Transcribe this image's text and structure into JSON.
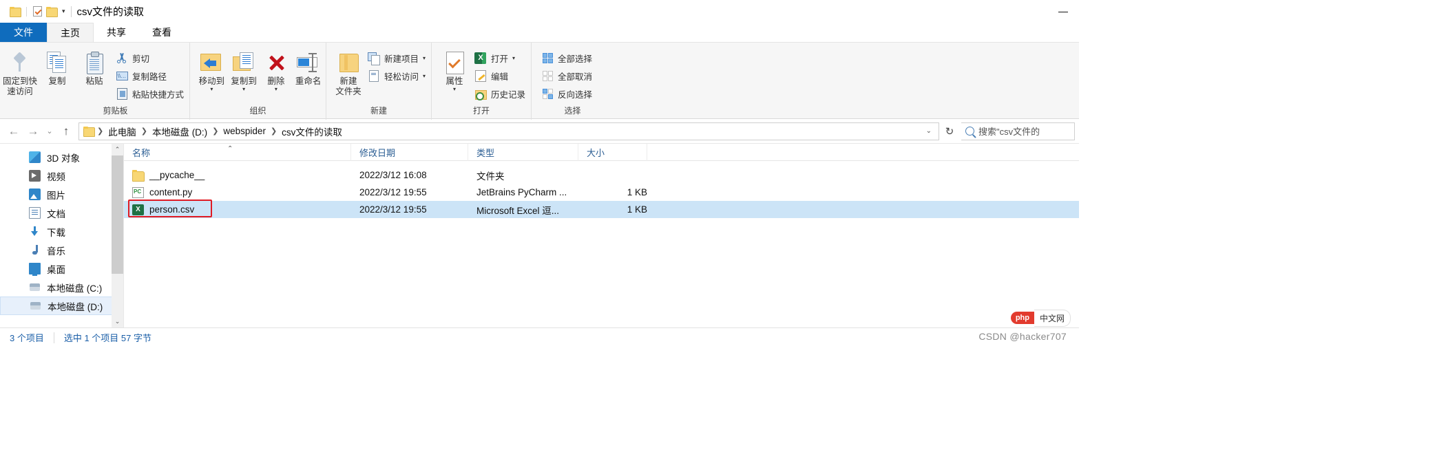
{
  "window": {
    "title": "csv文件的读取",
    "quick_access": [
      "folder-icon",
      "properties-check-icon",
      "new-folder-icon"
    ],
    "qat_caret": "▾",
    "minimize": "—"
  },
  "tabs": [
    {
      "label": "文件",
      "type": "file"
    },
    {
      "label": "主页",
      "type": "active"
    },
    {
      "label": "共享",
      "type": "normal"
    },
    {
      "label": "查看",
      "type": "normal"
    }
  ],
  "ribbon": {
    "groups": [
      {
        "label": "剪贴板",
        "big": [
          {
            "label_line1": "固定到快",
            "label_line2": "速访问",
            "icon": "pin-icon"
          },
          {
            "label_line1": "复制",
            "label_line2": "",
            "icon": "copy-icon"
          },
          {
            "label_line1": "粘贴",
            "label_line2": "",
            "icon": "paste-icon"
          }
        ],
        "small": [
          {
            "label": "剪切",
            "icon": "scissors-icon"
          },
          {
            "label": "复制路径",
            "icon": "copy-path-icon"
          },
          {
            "label": "粘贴快捷方式",
            "icon": "paste-shortcut-icon"
          }
        ]
      },
      {
        "label": "组织",
        "big": [
          {
            "label_line1": "移动到",
            "label_line2": "",
            "icon": "move-to-icon",
            "caret": "▾"
          },
          {
            "label_line1": "复制到",
            "label_line2": "",
            "icon": "copy-to-icon",
            "caret": "▾"
          },
          {
            "label_line1": "删除",
            "label_line2": "",
            "icon": "delete-icon",
            "caret": "▾"
          },
          {
            "label_line1": "重命名",
            "label_line2": "",
            "icon": "rename-icon"
          }
        ],
        "small": []
      },
      {
        "label": "新建",
        "big": [
          {
            "label_line1": "新建",
            "label_line2": "文件夹",
            "icon": "new-folder-icon"
          }
        ],
        "small": [
          {
            "label": "新建项目",
            "icon": "new-item-icon",
            "caret": "▾"
          },
          {
            "label": "轻松访问",
            "icon": "easy-access-icon",
            "caret": "▾"
          }
        ]
      },
      {
        "label": "打开",
        "big": [
          {
            "label_line1": "属性",
            "label_line2": "",
            "icon": "properties-icon",
            "caret": "▾"
          }
        ],
        "small": [
          {
            "label": "打开",
            "icon": "excel-icon",
            "caret": "▾"
          },
          {
            "label": "编辑",
            "icon": "edit-pencil-icon"
          },
          {
            "label": "历史记录",
            "icon": "history-icon"
          }
        ]
      },
      {
        "label": "选择",
        "big": [],
        "small": [
          {
            "label": "全部选择",
            "icon": "select-all-icon"
          },
          {
            "label": "全部取消",
            "icon": "select-none-icon"
          },
          {
            "label": "反向选择",
            "icon": "invert-selection-icon"
          }
        ]
      }
    ]
  },
  "address": {
    "back": "←",
    "forward": "→",
    "recent": "⌄",
    "up": "↑",
    "crumbs": [
      "此电脑",
      "本地磁盘 (D:)",
      "webspider",
      "csv文件的读取"
    ],
    "separator": "❯",
    "dropdown_caret": "⌄",
    "refresh": "↻",
    "search_placeholder": "搜索\"csv文件的"
  },
  "navpane": {
    "items": [
      {
        "label": "3D 对象",
        "icon": "3d-objects-icon",
        "selected": false
      },
      {
        "label": "视频",
        "icon": "videos-icon",
        "selected": false
      },
      {
        "label": "图片",
        "icon": "pictures-icon",
        "selected": false
      },
      {
        "label": "文档",
        "icon": "documents-icon",
        "selected": false
      },
      {
        "label": "下载",
        "icon": "downloads-icon",
        "selected": false
      },
      {
        "label": "音乐",
        "icon": "music-icon",
        "selected": false
      },
      {
        "label": "桌面",
        "icon": "desktop-icon",
        "selected": false
      },
      {
        "label": "本地磁盘 (C:)",
        "icon": "disk-icon",
        "selected": false
      },
      {
        "label": "本地磁盘 (D:)",
        "icon": "disk-icon",
        "selected": true
      }
    ],
    "scroll_up": "⌃",
    "scroll_down": "⌄"
  },
  "filelist": {
    "columns": [
      {
        "label": "名称",
        "sorted": true,
        "sort_caret": "⌃"
      },
      {
        "label": "修改日期"
      },
      {
        "label": "类型"
      },
      {
        "label": "大小"
      }
    ],
    "rows": [
      {
        "name": "__pycache__",
        "date": "2022/3/12 16:08",
        "type": "文件夹",
        "size": "",
        "icon": "folder-icon",
        "selected": false
      },
      {
        "name": "content.py",
        "date": "2022/3/12 19:55",
        "type": "JetBrains PyCharm ...",
        "size": "1 KB",
        "icon": "pycharm-file-icon",
        "selected": false
      },
      {
        "name": "person.csv",
        "date": "2022/3/12 19:55",
        "type": "Microsoft Excel 逗...",
        "size": "1 KB",
        "icon": "csv-file-icon",
        "selected": true
      }
    ],
    "highlight_color": "#e01b24"
  },
  "statusbar": {
    "items": [
      "3 个项目",
      "选中 1 个项目  57 字节"
    ]
  },
  "watermark": {
    "text": "CSDN @hacker707",
    "badge_left": "php",
    "badge_right": "中文网"
  }
}
